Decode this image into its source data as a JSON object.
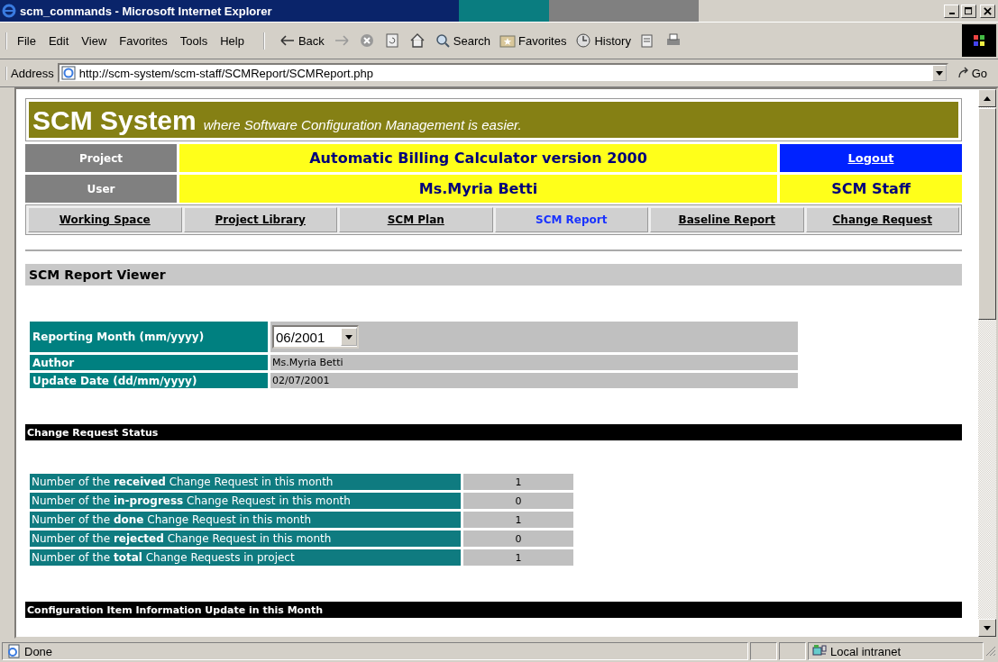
{
  "window": {
    "title": "scm_commands - Microsoft Internet Explorer"
  },
  "menu": [
    "File",
    "Edit",
    "View",
    "Favorites",
    "Tools",
    "Help"
  ],
  "toolbar": [
    {
      "kind": "back",
      "label": "Back"
    },
    {
      "kind": "forward"
    },
    {
      "kind": "stop"
    },
    {
      "kind": "refresh"
    },
    {
      "kind": "home"
    },
    {
      "kind": "search",
      "label": "Search"
    },
    {
      "kind": "favorites",
      "label": "Favorites"
    },
    {
      "kind": "history",
      "label": "History"
    },
    {
      "kind": "mail"
    },
    {
      "kind": "print"
    }
  ],
  "address": {
    "label": "Address",
    "value": "http://scm-system/scm-staff/SCMReport/SCMReport.php",
    "go": "Go"
  },
  "banner": {
    "title": "SCM System",
    "tagline": "where Software Configuration Management is easier."
  },
  "project": {
    "label": "Project",
    "value": "Automatic Billing Calculator version 2000",
    "logout": "Logout"
  },
  "user": {
    "label": "User",
    "value": "Ms.Myria Betti",
    "role": "SCM Staff"
  },
  "nav": [
    {
      "label": "Working Space",
      "selected": false
    },
    {
      "label": "Project Library",
      "selected": false
    },
    {
      "label": "SCM Plan",
      "selected": false
    },
    {
      "label": "SCM Report",
      "selected": true
    },
    {
      "label": "Baseline Report",
      "selected": false
    },
    {
      "label": "Change Request",
      "selected": false
    }
  ],
  "viewer_title": "SCM Report Viewer",
  "form": {
    "reporting_month": {
      "label": "Reporting Month (mm/yyyy)",
      "value": "06/2001"
    },
    "author": {
      "label": "Author",
      "value": "Ms.Myria Betti"
    },
    "update_date": {
      "label": "Update Date (dd/mm/yyyy)",
      "value": "02/07/2001"
    }
  },
  "sections": [
    {
      "title": "Change Request Status",
      "rows": [
        {
          "label": "Number of the **received** Change Request in this month",
          "value": "1"
        },
        {
          "label": "Number of the **in-progress** Change Request in this month",
          "value": "0"
        },
        {
          "label": "Number of the **done** Change Request in this month",
          "value": "1"
        },
        {
          "label": "Number of the **rejected** Change Request in this month",
          "value": "0"
        },
        {
          "label": "Number of the **total** Change Requests in project",
          "value": "1"
        }
      ]
    },
    {
      "title": "Configuration Item Information Update in this Month"
    }
  ],
  "status_bar": {
    "text": "Done",
    "zone": "Local intranet"
  }
}
